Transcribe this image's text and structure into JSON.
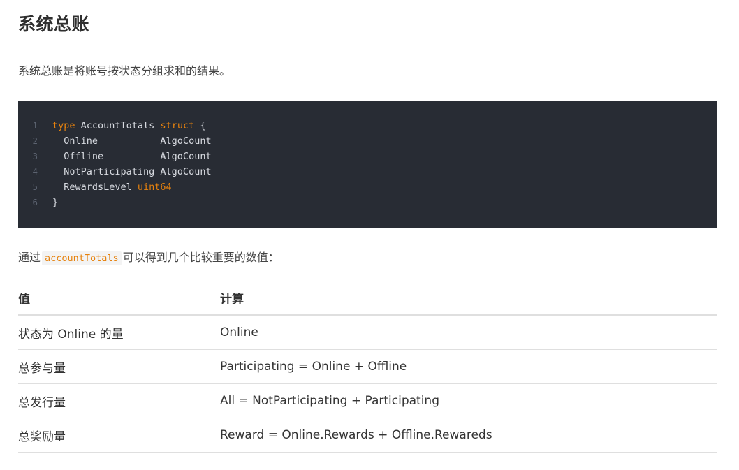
{
  "heading": "系统总账",
  "intro": "系统总账是将账号按状态分组求和的结果。",
  "code": {
    "lines": [
      {
        "num": "1",
        "tokens": [
          {
            "t": "type",
            "k": "kw"
          },
          {
            "t": " AccountTotals ",
            "k": "tx"
          },
          {
            "t": "struct",
            "k": "kw"
          },
          {
            "t": " {",
            "k": "tx"
          }
        ]
      },
      {
        "num": "2",
        "tokens": [
          {
            "t": "  Online           AlgoCount",
            "k": "tx"
          }
        ]
      },
      {
        "num": "3",
        "tokens": [
          {
            "t": "  Offline          AlgoCount",
            "k": "tx"
          }
        ]
      },
      {
        "num": "4",
        "tokens": [
          {
            "t": "  NotParticipating AlgoCount",
            "k": "tx"
          }
        ]
      },
      {
        "num": "5",
        "tokens": [
          {
            "t": "  RewardsLevel ",
            "k": "tx"
          },
          {
            "t": "uint64",
            "k": "kw"
          }
        ]
      },
      {
        "num": "6",
        "tokens": [
          {
            "t": "}",
            "k": "tx"
          }
        ]
      }
    ]
  },
  "para": {
    "before": "通过",
    "code": "accountTotals",
    "after": "可以得到几个比较重要的数值："
  },
  "table": {
    "headers": [
      "值",
      "计算"
    ],
    "rows": [
      [
        "状态为 Online 的量",
        "Online"
      ],
      [
        "总参与量",
        "Participating = Online + Offline"
      ],
      [
        "总发行量",
        "All = NotParticipating + Participating"
      ],
      [
        "总奖励量",
        "Reward = Online.Rewards + Offline.Rewareds"
      ]
    ]
  },
  "colors": {
    "code_bg": "#282c34",
    "keyword": "#e6820e",
    "code_text": "#d7dae0",
    "line_number": "#5c6370"
  }
}
